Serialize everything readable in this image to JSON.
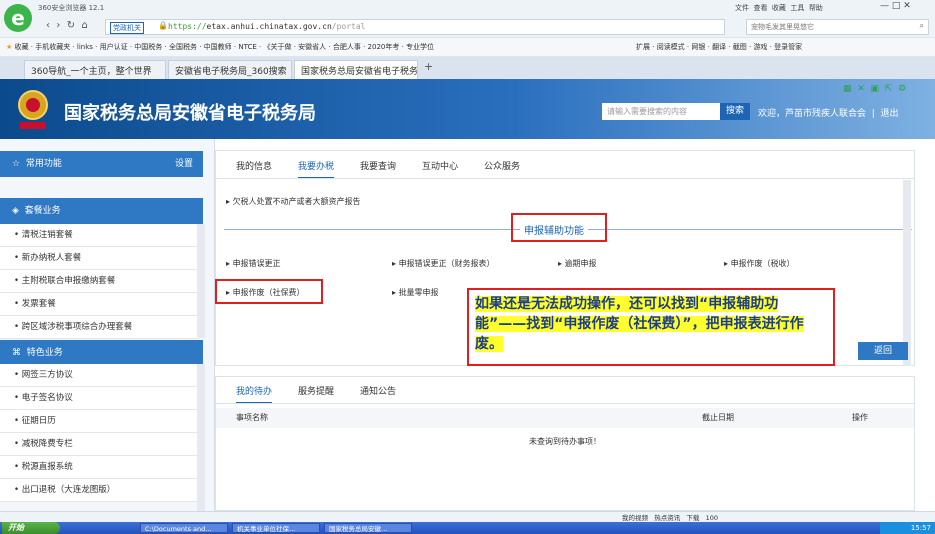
{
  "browser": {
    "app_title": "360安全浏览器 12.1",
    "menu": [
      "文件",
      "查看",
      "收藏",
      "工具",
      "帮助"
    ],
    "address_badge": "党政机关",
    "address_protocol": "https://",
    "address_host": "etax.anhui.chinatax.gov.cn",
    "address_path": "/portal",
    "search_placeholder": "宠物毛发其里晃悠它",
    "bookmarks": [
      "收藏",
      "手机收藏夹",
      "links",
      "用户认证",
      "中国税务",
      "全国税务",
      "中国教师",
      "NTCE",
      "《关于做",
      "安徽省人",
      "合肥人事",
      "2020年考",
      "专业学位"
    ],
    "bookmarks_right": [
      "扩展",
      "阅读模式",
      "网银",
      "翻译",
      "截图",
      "游戏",
      "登录管家"
    ],
    "tabs": [
      "360导航_一个主页，整个世界",
      "安徽省电子税务局_360搜索",
      "国家税务总局安徽省电子税务局"
    ]
  },
  "site": {
    "title": "国家税务总局安徽省电子税务局",
    "search_placeholder": "请输入需要搜索的内容",
    "search_button": "搜索",
    "welcome_text": "欢迎，芦苗市残疾人联合会",
    "logout": "退出"
  },
  "sidebar": {
    "common_header": "常用功能",
    "settings": "设置",
    "package_header": "套餐业务",
    "package_items": [
      "清税注销套餐",
      "新办纳税人套餐",
      "主附税联合申报缴纳套餐",
      "发票套餐",
      "跨区域涉税事项综合办理套餐"
    ],
    "special_header": "特色业务",
    "special_items": [
      "网签三方协议",
      "电子签名协议",
      "征期日历",
      "减税降费专栏",
      "税源直报系统",
      "出口退税（大连龙图版）"
    ]
  },
  "main": {
    "tabs": [
      "我的信息",
      "我要办税",
      "我要查询",
      "互动中心",
      "公众服务"
    ],
    "active_tab": "我要办税",
    "top_link": "欠税人处置不动产或者大额资产报告",
    "section_title": "申报辅助功能",
    "row1": [
      "申报错误更正",
      "申报错误更正（财务报表）",
      "逾期申报",
      "申报作废（税收）"
    ],
    "row2": [
      "申报作废（社保费）",
      "批量零申报"
    ],
    "return_button": "返回"
  },
  "callout": {
    "text": "如果还是无法成功操作，还可以找到“申报辅助功能”——找到“申报作废（社保费）”，把申报表进行作废。"
  },
  "lower": {
    "tabs": [
      "我的待办",
      "服务提醒",
      "通知公告"
    ],
    "col_name": "事项名称",
    "col_deadline": "截止日期",
    "col_action": "操作",
    "empty_text": "未查询到待办事项！"
  },
  "status": {
    "items": [
      "我的视频",
      "热点资讯",
      "下载"
    ],
    "zoom": "100"
  },
  "taskbar": {
    "start": "开始",
    "tasks": [
      "C:\\Documents and...",
      "机关事业单位社保...",
      "国家税务总局安徽..."
    ],
    "time": "15:57"
  },
  "colors": {
    "header_blue": "#0b4a8c",
    "accent_blue": "#1d64b4",
    "sidebar_head": "#2f78c4",
    "highlight_red": "#e02020",
    "highlight_yellow": "#ffff2e"
  }
}
